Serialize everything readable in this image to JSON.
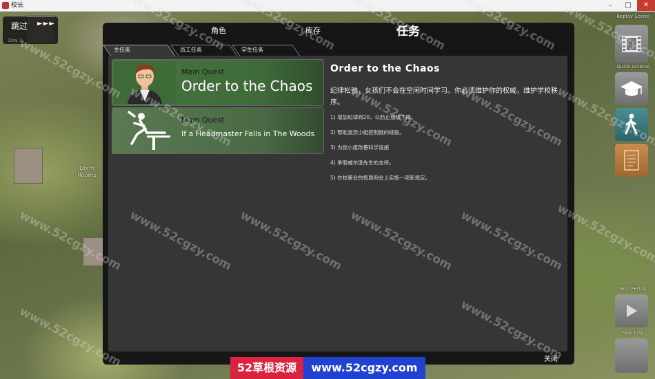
{
  "window": {
    "title": "校长",
    "minimize": "–",
    "maximize": "□",
    "close": "✕"
  },
  "skip": {
    "label": "跳过",
    "arrows": "►►►",
    "sub": "Day 2"
  },
  "map": {
    "dorm_label": "Dorm\nRooms"
  },
  "sidepanel": {
    "replay_caption": "Replay Scene",
    "quick_actions_caption": "Quick Actions",
    "skip_period_caption": "Skip Period",
    "skip_day_caption": "Skip Day",
    "icons": [
      "film-icon",
      "graduation-cap-icon",
      "walking-person-icon",
      "notes-icon",
      "play-icon"
    ]
  },
  "dialog": {
    "tabs": [
      {
        "label": "角色"
      },
      {
        "label": "库存"
      },
      {
        "label": "任务"
      }
    ],
    "subtabs": [
      {
        "label": "主任务"
      },
      {
        "label": "员工任务"
      },
      {
        "label": "学生任务"
      }
    ],
    "quests": [
      {
        "type": "Main Quest",
        "name": "Order to the Chaos"
      },
      {
        "type": "Main Quest",
        "name": "If a Headmaster Falls in The Woods"
      }
    ],
    "detail": {
      "title": "Order to the Chaos",
      "description": "纪律松弛，女孩们不会在空闲时间学习。你必须维护你的权威，维护学校秩序。",
      "items": [
        "1) 增加纪律到20，以防止成绩下降。",
        "2) 帮助波茨小姐控制她的班级。",
        "3) 为张小姐改善科学设施",
        "4) 争取威尔逊先生的支持。",
        "5) 在校董会的每周例会上实施一项新规定。"
      ]
    },
    "close_label": "关闭"
  },
  "watermark": {
    "text": "www.52cgzy.com"
  },
  "banner": {
    "left": "52草根资源",
    "right": "www.52cgzy.com"
  }
}
